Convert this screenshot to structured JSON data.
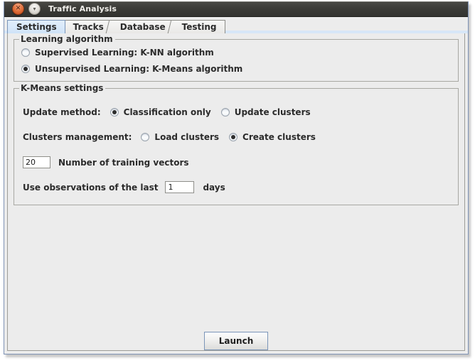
{
  "window": {
    "title": "Traffic Analysis",
    "buttons": [
      {
        "name": "close",
        "glyph": "✕"
      },
      {
        "name": "minimize",
        "glyph": "▾"
      }
    ]
  },
  "tabs": [
    {
      "label": "Settings",
      "selected": true
    },
    {
      "label": "Tracks",
      "selected": false
    },
    {
      "label": "Database",
      "selected": false
    },
    {
      "label": "Testing",
      "selected": false
    }
  ],
  "learning_algorithm": {
    "legend": "Learning algorithm",
    "options": [
      {
        "label": "Supervised Learning: K-NN algorithm",
        "checked": false
      },
      {
        "label": "Unsupervised Learning: K-Means algorithm",
        "checked": true
      }
    ]
  },
  "kmeans_settings": {
    "legend": "K-Means settings",
    "update_method": {
      "label": "Update method:",
      "options": [
        {
          "label": "Classification only",
          "checked": true
        },
        {
          "label": "Update clusters",
          "checked": false
        }
      ]
    },
    "clusters_management": {
      "label": "Clusters management:",
      "options": [
        {
          "label": "Load clusters",
          "checked": false
        },
        {
          "label": "Create clusters",
          "checked": true
        }
      ]
    },
    "training_vectors": {
      "value": "20",
      "label": "Number of training vectors"
    },
    "observations": {
      "prefix": "Use observations of the last",
      "value": "1",
      "suffix": "days"
    }
  },
  "launch": {
    "label": "Launch"
  },
  "colors": {
    "window_background": "#ececec",
    "titlebar": "#3b3b37",
    "selected_tab": "#cfe3f8",
    "accent_border": "#7b95b8",
    "close_button": "#e2703a"
  }
}
